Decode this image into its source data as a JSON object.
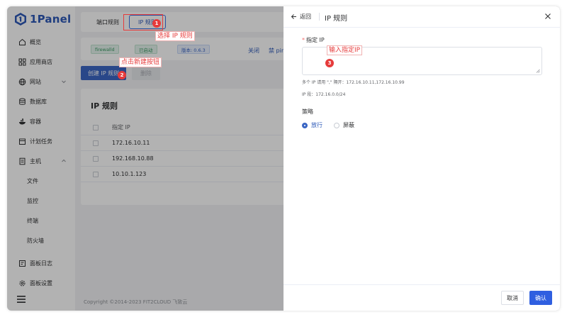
{
  "sidebar": {
    "logo_text": "1Panel",
    "items": [
      {
        "label": "概览",
        "icon": "home-icon"
      },
      {
        "label": "应用商店",
        "icon": "grid-icon"
      },
      {
        "label": "网站",
        "icon": "globe-icon"
      },
      {
        "label": "数据库",
        "icon": "database-icon"
      },
      {
        "label": "容器",
        "icon": "whale-icon"
      },
      {
        "label": "计划任务",
        "icon": "calendar-icon"
      },
      {
        "label": "主机",
        "icon": "document-icon"
      },
      {
        "label": "文件"
      },
      {
        "label": "监控"
      },
      {
        "label": "终端"
      },
      {
        "label": "防火墙"
      },
      {
        "label": "面板日志",
        "icon": "log-icon"
      },
      {
        "label": "面板设置",
        "icon": "gear-icon"
      }
    ]
  },
  "tabs": [
    {
      "label": "端口规则"
    },
    {
      "label": "IP 规则"
    }
  ],
  "status": {
    "tag_name": "firewalld",
    "tag_state": "已启动",
    "tag_version": "版本: 0.6.3",
    "link_close": "关闭",
    "link_ping": "禁 ping"
  },
  "toolbar": {
    "create_label": "创建 IP 规则",
    "delete_label": "删除"
  },
  "table": {
    "title": "IP 规则",
    "header": "指定 IP",
    "rows": [
      "172.16.10.11",
      "192.168.10.88",
      "10.10.1.123"
    ]
  },
  "footer": {
    "text": "Copyright ©2014-2023 FIT2CLOUD 飞致云"
  },
  "drawer": {
    "back_label": "返回",
    "title": "IP 规则",
    "field_label": "指定 IP",
    "required_mark": "*",
    "hint_multi": "多个 IP 请用 \",\" 隔开：172.16.10.11,172.16.10.99",
    "hint_segment": "IP 段：172.16.0.0/24",
    "policy_label": "策略",
    "policy_options": [
      "放行",
      "屏蔽"
    ],
    "policy_selected": "放行",
    "cancel_label": "取消",
    "confirm_label": "确认"
  },
  "annotations": [
    {
      "num": "1",
      "text": "选择 IP 规则"
    },
    {
      "num": "2",
      "text": "点击新建按钮"
    },
    {
      "num": "3",
      "text": "输入指定IP"
    }
  ],
  "colors": {
    "primary": "#3b66c4",
    "confirm": "#2f5fe0",
    "annotation": "#e63b3b",
    "success_tag": "#3a9a64"
  }
}
